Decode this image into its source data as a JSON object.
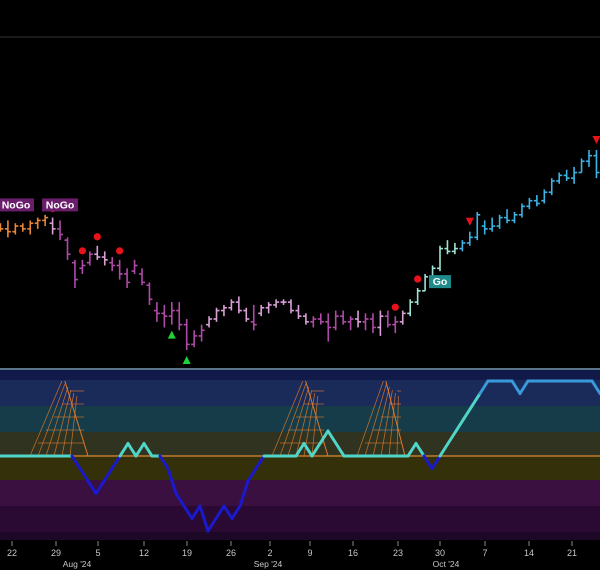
{
  "chart_data": {
    "type": "ohlc",
    "grid": false,
    "x_axis": {
      "day_ticks": [
        "22",
        "29",
        "5",
        "12",
        "19",
        "26",
        "2",
        "9",
        "16",
        "23",
        "30",
        "7",
        "14",
        "21"
      ],
      "month_ticks": [
        "Aug '24",
        "Sep '24",
        "Oct '24"
      ]
    },
    "price_panel": {
      "bar_colors": {
        "strong_go": "#3cb4e6",
        "weak_go": "#9fe3d4",
        "nogo": "#b04aa8",
        "weak_nogo": "#d9a0d6",
        "go_fading": "#e8873a"
      },
      "labels": [
        {
          "text": "NoGo",
          "color": "#6a1d6a"
        },
        {
          "text": "NoGo",
          "color": "#6a1d6a"
        },
        {
          "text": "Go",
          "color": "#1f8a8a"
        }
      ],
      "bars": [
        {
          "i": 0,
          "o": 60,
          "h": 62,
          "l": 58,
          "c": 61,
          "t": "go_fading"
        },
        {
          "i": 1,
          "o": 61,
          "h": 62,
          "l": 59,
          "c": 60,
          "t": "go_fading"
        },
        {
          "i": 2,
          "o": 60,
          "h": 63,
          "l": 57,
          "c": 59,
          "t": "go_fading"
        },
        {
          "i": 3,
          "o": 59,
          "h": 62,
          "l": 58,
          "c": 61,
          "t": "go_fading"
        },
        {
          "i": 4,
          "o": 61,
          "h": 62,
          "l": 59,
          "c": 60,
          "t": "go_fading"
        },
        {
          "i": 5,
          "o": 60,
          "h": 63,
          "l": 58,
          "c": 62,
          "t": "go_fading"
        },
        {
          "i": 6,
          "o": 62,
          "h": 64,
          "l": 60,
          "c": 63,
          "t": "go_fading"
        },
        {
          "i": 7,
          "o": 63,
          "h": 65,
          "l": 61,
          "c": 64,
          "t": "go_fading"
        },
        {
          "i": 8,
          "o": 62,
          "h": 64,
          "l": 58,
          "c": 60,
          "t": "weak_nogo"
        },
        {
          "i": 9,
          "o": 60,
          "h": 63,
          "l": 56,
          "c": 58,
          "t": "nogo"
        },
        {
          "i": 10,
          "o": 56,
          "h": 57,
          "l": 49,
          "c": 51,
          "t": "nogo"
        },
        {
          "i": 11,
          "o": 48,
          "h": 49,
          "l": 39,
          "c": 42,
          "t": "nogo"
        },
        {
          "i": 12,
          "o": 46,
          "h": 49,
          "l": 44,
          "c": 47,
          "t": "nogo"
        },
        {
          "i": 13,
          "o": 48,
          "h": 52,
          "l": 47,
          "c": 51,
          "t": "nogo"
        },
        {
          "i": 14,
          "o": 51,
          "h": 54,
          "l": 49,
          "c": 50,
          "t": "weak_nogo"
        },
        {
          "i": 15,
          "o": 50,
          "h": 52,
          "l": 47,
          "c": 49,
          "t": "weak_nogo"
        },
        {
          "i": 16,
          "o": 48,
          "h": 50,
          "l": 45,
          "c": 47,
          "t": "nogo"
        },
        {
          "i": 17,
          "o": 47,
          "h": 49,
          "l": 42,
          "c": 44,
          "t": "nogo"
        },
        {
          "i": 18,
          "o": 44,
          "h": 46,
          "l": 39,
          "c": 41,
          "t": "nogo"
        },
        {
          "i": 19,
          "o": 45,
          "h": 49,
          "l": 44,
          "c": 47,
          "t": "nogo"
        },
        {
          "i": 20,
          "o": 44,
          "h": 46,
          "l": 40,
          "c": 41,
          "t": "nogo"
        },
        {
          "i": 21,
          "o": 40,
          "h": 41,
          "l": 33,
          "c": 35,
          "t": "nogo"
        },
        {
          "i": 22,
          "o": 31,
          "h": 34,
          "l": 27,
          "c": 30,
          "t": "nogo"
        },
        {
          "i": 23,
          "o": 30,
          "h": 33,
          "l": 25,
          "c": 29,
          "t": "nogo"
        },
        {
          "i": 24,
          "o": 29,
          "h": 34,
          "l": 26,
          "c": 31,
          "t": "nogo"
        },
        {
          "i": 25,
          "o": 31,
          "h": 34,
          "l": 24,
          "c": 26,
          "t": "nogo"
        },
        {
          "i": 26,
          "o": 26,
          "h": 28,
          "l": 17,
          "c": 19,
          "t": "nogo"
        },
        {
          "i": 27,
          "o": 19,
          "h": 24,
          "l": 18,
          "c": 22,
          "t": "nogo"
        },
        {
          "i": 28,
          "o": 22,
          "h": 26,
          "l": 20,
          "c": 24,
          "t": "nogo"
        },
        {
          "i": 29,
          "o": 26,
          "h": 29,
          "l": 25,
          "c": 28,
          "t": "weak_nogo"
        },
        {
          "i": 30,
          "o": 28,
          "h": 32,
          "l": 27,
          "c": 31,
          "t": "weak_nogo"
        },
        {
          "i": 31,
          "o": 31,
          "h": 33,
          "l": 29,
          "c": 32,
          "t": "weak_nogo"
        },
        {
          "i": 32,
          "o": 32,
          "h": 35,
          "l": 31,
          "c": 34,
          "t": "weak_nogo"
        },
        {
          "i": 33,
          "o": 34,
          "h": 36,
          "l": 30,
          "c": 31,
          "t": "weak_nogo"
        },
        {
          "i": 34,
          "o": 31,
          "h": 32,
          "l": 27,
          "c": 28,
          "t": "weak_nogo"
        },
        {
          "i": 35,
          "o": 27,
          "h": 33,
          "l": 24,
          "c": 26,
          "t": "nogo"
        },
        {
          "i": 36,
          "o": 30,
          "h": 33,
          "l": 29,
          "c": 32,
          "t": "weak_nogo"
        },
        {
          "i": 37,
          "o": 32,
          "h": 34,
          "l": 30,
          "c": 33,
          "t": "weak_nogo"
        },
        {
          "i": 38,
          "o": 33,
          "h": 35,
          "l": 32,
          "c": 34,
          "t": "weak_nogo"
        },
        {
          "i": 39,
          "o": 34,
          "h": 35,
          "l": 33,
          "c": 34,
          "t": "weak_nogo"
        },
        {
          "i": 40,
          "o": 34,
          "h": 35,
          "l": 30,
          "c": 31,
          "t": "weak_nogo"
        },
        {
          "i": 41,
          "o": 31,
          "h": 33,
          "l": 28,
          "c": 29,
          "t": "weak_nogo"
        },
        {
          "i": 42,
          "o": 29,
          "h": 30,
          "l": 26,
          "c": 27,
          "t": "weak_nogo"
        },
        {
          "i": 43,
          "o": 27,
          "h": 29,
          "l": 25,
          "c": 28,
          "t": "nogo"
        },
        {
          "i": 44,
          "o": 28,
          "h": 30,
          "l": 26,
          "c": 27,
          "t": "nogo"
        },
        {
          "i": 45,
          "o": 27,
          "h": 30,
          "l": 20,
          "c": 25,
          "t": "nogo"
        },
        {
          "i": 46,
          "o": 25,
          "h": 31,
          "l": 24,
          "c": 29,
          "t": "nogo"
        },
        {
          "i": 47,
          "o": 29,
          "h": 31,
          "l": 26,
          "c": 27,
          "t": "nogo"
        },
        {
          "i": 48,
          "o": 27,
          "h": 29,
          "l": 24,
          "c": 28,
          "t": "nogo"
        },
        {
          "i": 49,
          "o": 28,
          "h": 31,
          "l": 25,
          "c": 27,
          "t": "weak_nogo"
        },
        {
          "i": 50,
          "o": 27,
          "h": 30,
          "l": 24,
          "c": 28,
          "t": "nogo"
        },
        {
          "i": 51,
          "o": 28,
          "h": 30,
          "l": 23,
          "c": 25,
          "t": "nogo"
        },
        {
          "i": 52,
          "o": 25,
          "h": 31,
          "l": 22,
          "c": 29,
          "t": "weak_nogo"
        },
        {
          "i": 53,
          "o": 29,
          "h": 31,
          "l": 25,
          "c": 26,
          "t": "nogo"
        },
        {
          "i": 54,
          "o": 26,
          "h": 29,
          "l": 23,
          "c": 27,
          "t": "nogo"
        },
        {
          "i": 55,
          "o": 27,
          "h": 31,
          "l": 26,
          "c": 30,
          "t": "weak_nogo"
        },
        {
          "i": 56,
          "o": 30,
          "h": 35,
          "l": 29,
          "c": 34,
          "t": "weak_go"
        },
        {
          "i": 57,
          "o": 34,
          "h": 39,
          "l": 33,
          "c": 38,
          "t": "weak_go"
        },
        {
          "i": 58,
          "o": 38,
          "h": 44,
          "l": 38,
          "c": 43,
          "t": "weak_go"
        },
        {
          "i": 59,
          "o": 43,
          "h": 47,
          "l": 42,
          "c": 46,
          "t": "weak_go"
        },
        {
          "i": 60,
          "o": 46,
          "h": 54,
          "l": 45,
          "c": 53,
          "t": "weak_go"
        },
        {
          "i": 61,
          "o": 53,
          "h": 56,
          "l": 51,
          "c": 52,
          "t": "weak_go"
        },
        {
          "i": 62,
          "o": 52,
          "h": 55,
          "l": 51,
          "c": 53,
          "t": "weak_go"
        },
        {
          "i": 63,
          "o": 53,
          "h": 56,
          "l": 52,
          "c": 55,
          "t": "strong_go"
        },
        {
          "i": 64,
          "o": 55,
          "h": 59,
          "l": 54,
          "c": 57,
          "t": "strong_go"
        },
        {
          "i": 65,
          "o": 57,
          "h": 66,
          "l": 56,
          "c": 65,
          "t": "strong_go"
        },
        {
          "i": 66,
          "o": 61,
          "h": 63,
          "l": 58,
          "c": 60,
          "t": "strong_go"
        },
        {
          "i": 67,
          "o": 60,
          "h": 64,
          "l": 59,
          "c": 61,
          "t": "strong_go"
        },
        {
          "i": 68,
          "o": 61,
          "h": 65,
          "l": 60,
          "c": 64,
          "t": "strong_go"
        },
        {
          "i": 69,
          "o": 64,
          "h": 67,
          "l": 62,
          "c": 63,
          "t": "strong_go"
        },
        {
          "i": 70,
          "o": 63,
          "h": 66,
          "l": 62,
          "c": 65,
          "t": "strong_go"
        },
        {
          "i": 71,
          "o": 65,
          "h": 69,
          "l": 64,
          "c": 68,
          "t": "strong_go"
        },
        {
          "i": 72,
          "o": 68,
          "h": 71,
          "l": 67,
          "c": 70,
          "t": "strong_go"
        },
        {
          "i": 73,
          "o": 70,
          "h": 72,
          "l": 68,
          "c": 69,
          "t": "strong_go"
        },
        {
          "i": 74,
          "o": 70,
          "h": 74,
          "l": 69,
          "c": 73,
          "t": "strong_go"
        },
        {
          "i": 75,
          "o": 73,
          "h": 78,
          "l": 72,
          "c": 77,
          "t": "strong_go"
        },
        {
          "i": 76,
          "o": 77,
          "h": 80,
          "l": 76,
          "c": 79,
          "t": "strong_go"
        },
        {
          "i": 77,
          "o": 79,
          "h": 81,
          "l": 77,
          "c": 78,
          "t": "strong_go"
        },
        {
          "i": 78,
          "o": 78,
          "h": 82,
          "l": 76,
          "c": 80,
          "t": "strong_go"
        },
        {
          "i": 79,
          "o": 80,
          "h": 85,
          "l": 80,
          "c": 84,
          "t": "strong_go"
        },
        {
          "i": 80,
          "o": 84,
          "h": 88,
          "l": 82,
          "c": 86,
          "t": "strong_go"
        },
        {
          "i": 81,
          "o": 86,
          "h": 88,
          "l": 78,
          "c": 80,
          "t": "strong_go"
        }
      ],
      "red_dots": [
        8,
        12,
        14,
        17,
        54,
        57
      ],
      "green_up_triangles": [
        24,
        26
      ],
      "red_down_triangles": [
        64,
        81
      ]
    },
    "oscillator_panel": {
      "zero_line_color": "#e08a30",
      "line_colors": {
        "above": "#4fd6c8",
        "below": "#1a1acc",
        "strong": "#3a9ad9"
      },
      "values": [
        0,
        0,
        0,
        0,
        0,
        0,
        0,
        0,
        0,
        0,
        -1,
        -2,
        -3,
        -2,
        -1,
        0,
        1,
        0,
        1,
        0,
        0,
        -1,
        -3,
        -4,
        -5,
        -4,
        -6,
        -5,
        -4,
        -5,
        -4,
        -2,
        -1,
        0,
        0,
        0,
        0,
        0,
        1,
        0,
        1,
        2,
        1,
        0,
        0,
        0,
        0,
        0,
        0,
        0,
        0,
        0,
        1,
        0,
        -1,
        0,
        1,
        2,
        3,
        4,
        5,
        6,
        6,
        6,
        6,
        5,
        6,
        6,
        6,
        6,
        6,
        6,
        6,
        6,
        6,
        5
      ]
    }
  }
}
